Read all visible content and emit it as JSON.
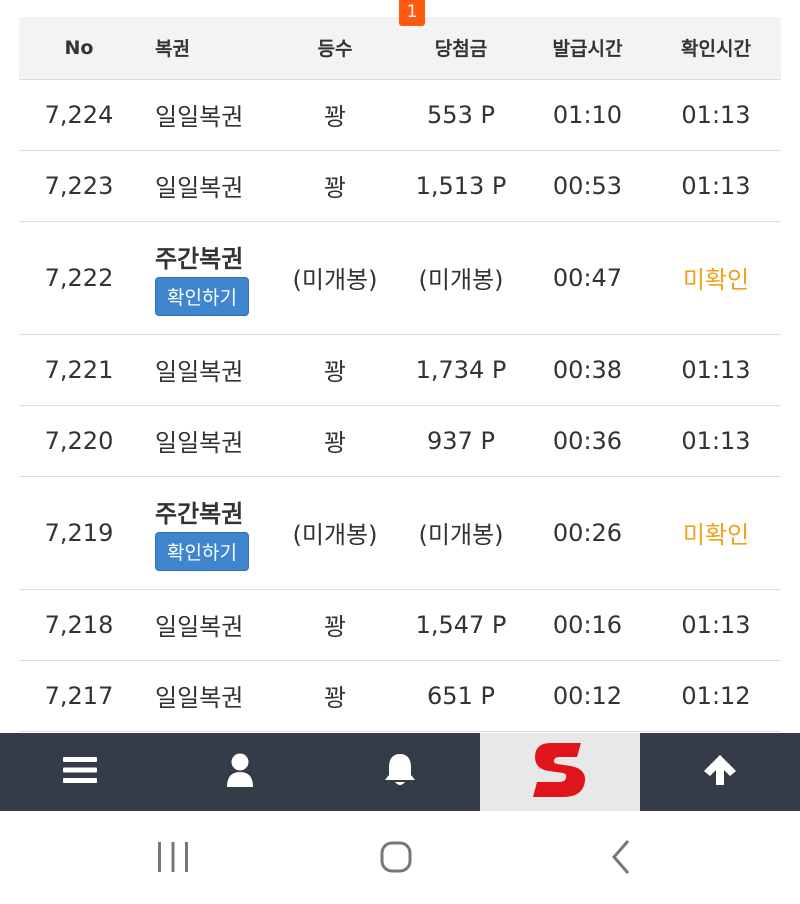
{
  "table": {
    "headers": {
      "no": "No",
      "lottery": "복권",
      "rank": "등수",
      "prize": "당첨금",
      "issued": "발급시간",
      "checked": "확인시간"
    },
    "rows": [
      {
        "no": "7,224",
        "lottery": "일일복권",
        "rank": "꽝",
        "prize": "553 P",
        "issued": "01:10",
        "checked": "01:13"
      },
      {
        "no": "7,223",
        "lottery": "일일복권",
        "rank": "꽝",
        "prize": "1,513 P",
        "issued": "00:53",
        "checked": "01:13"
      },
      {
        "no": "7,222",
        "lottery": "주간복권",
        "button": "확인하기",
        "rank": "(미개봉)",
        "prize": "(미개봉)",
        "issued": "00:47",
        "checked": "미확인"
      },
      {
        "no": "7,221",
        "lottery": "일일복권",
        "rank": "꽝",
        "prize": "1,734 P",
        "issued": "00:38",
        "checked": "01:13"
      },
      {
        "no": "7,220",
        "lottery": "일일복권",
        "rank": "꽝",
        "prize": "937 P",
        "issued": "00:36",
        "checked": "01:13"
      },
      {
        "no": "7,219",
        "lottery": "주간복권",
        "button": "확인하기",
        "rank": "(미개봉)",
        "prize": "(미개봉)",
        "issued": "00:26",
        "checked": "미확인"
      },
      {
        "no": "7,218",
        "lottery": "일일복권",
        "rank": "꽝",
        "prize": "1,547 P",
        "issued": "00:16",
        "checked": "01:13"
      },
      {
        "no": "7,217",
        "lottery": "일일복권",
        "rank": "꽝",
        "prize": "651 P",
        "issued": "00:12",
        "checked": "01:12"
      }
    ]
  },
  "bottom_bar": {
    "notification_count": "1",
    "icons": [
      "menu-icon",
      "user-icon",
      "bell-icon",
      "site-logo",
      "arrow-up-icon"
    ]
  },
  "system_nav": {
    "icons": [
      "recent-apps-icon",
      "home-icon",
      "back-icon"
    ]
  },
  "colors": {
    "header_bg": "#f3f3f3",
    "bar_bg": "#333c47",
    "button_blue": "#3f86cf",
    "unconfirmed": "#f0a21a",
    "badge": "#ff5a10",
    "logo_red": "#e0141b"
  }
}
